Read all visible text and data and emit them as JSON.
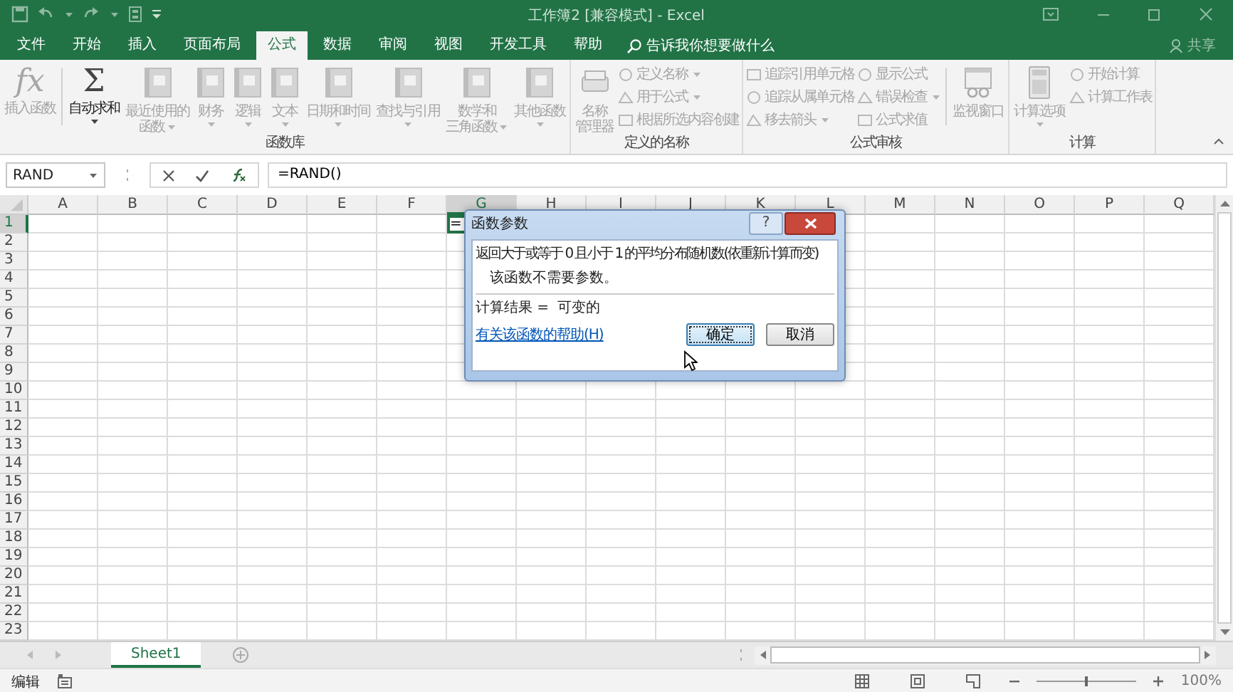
{
  "window": {
    "title": "工作簿2 [兼容模式] - Excel"
  },
  "tabs": [
    {
      "label": "文件",
      "selected": false
    },
    {
      "label": "开始",
      "selected": false
    },
    {
      "label": "插入",
      "selected": false
    },
    {
      "label": "页面布局",
      "selected": false
    },
    {
      "label": "公式",
      "selected": true
    },
    {
      "label": "数据",
      "selected": false
    },
    {
      "label": "审阅",
      "selected": false
    },
    {
      "label": "视图",
      "selected": false
    },
    {
      "label": "开发工具",
      "selected": false
    },
    {
      "label": "帮助",
      "selected": false
    }
  ],
  "tell_me": {
    "placeholder": "告诉我你想要做什么"
  },
  "share": "共享",
  "ribbon": {
    "groups": [
      {
        "label": "函数库",
        "items": [
          {
            "kind": "large",
            "glyph": "fx",
            "label": [
              "插入函数"
            ],
            "disabled": true,
            "separator_after": true
          },
          {
            "kind": "large",
            "glyph": "Σ",
            "label": [
              "自动求和"
            ],
            "disabled": false,
            "dropdown": true
          },
          {
            "kind": "large",
            "label": [
              "最近使用的",
              "函数"
            ],
            "disabled": true,
            "dropdown": true
          },
          {
            "kind": "large",
            "label": [
              "财务"
            ],
            "disabled": true,
            "dropdown": true
          },
          {
            "kind": "large",
            "label": [
              "逻辑"
            ],
            "disabled": true,
            "dropdown": true
          },
          {
            "kind": "large",
            "label": [
              "文本"
            ],
            "disabled": true,
            "dropdown": true
          },
          {
            "kind": "large",
            "label": [
              "日期和时间"
            ],
            "disabled": true,
            "dropdown": true
          },
          {
            "kind": "large",
            "label": [
              "查找与引用"
            ],
            "disabled": true,
            "dropdown": true
          },
          {
            "kind": "large",
            "label": [
              "数学和",
              "三角函数"
            ],
            "disabled": true,
            "dropdown": true
          },
          {
            "kind": "large",
            "label": [
              "其他函数"
            ],
            "disabled": true,
            "dropdown": true
          }
        ]
      },
      {
        "label": "定义的名称",
        "items": [
          {
            "kind": "large",
            "label": [
              "名称",
              "管理器"
            ],
            "disabled": true
          },
          {
            "kind": "column",
            "buttons": [
              {
                "label": "定义名称",
                "disabled": true,
                "dropdown": true
              },
              {
                "label": "用于公式",
                "disabled": true,
                "dropdown": true
              },
              {
                "label": "根据所选内容创建",
                "disabled": true
              }
            ]
          }
        ]
      },
      {
        "label": "公式审核",
        "items": [
          {
            "kind": "column",
            "buttons": [
              {
                "label": "追踪引用单元格",
                "disabled": true
              },
              {
                "label": "追踪从属单元格",
                "disabled": true
              },
              {
                "label": "移去箭头",
                "disabled": true,
                "dropdown": true
              }
            ]
          },
          {
            "kind": "column",
            "separator_after": true,
            "buttons": [
              {
                "label": "显示公式",
                "disabled": true
              },
              {
                "label": "错误检查",
                "disabled": true,
                "dropdown": true
              },
              {
                "label": "公式求值",
                "disabled": true
              }
            ]
          },
          {
            "kind": "large",
            "label": [
              "监视窗口"
            ],
            "disabled": true
          }
        ]
      },
      {
        "label": "计算",
        "items": [
          {
            "kind": "large",
            "label": [
              "计算选项"
            ],
            "disabled": true,
            "dropdown": true
          },
          {
            "kind": "column",
            "buttons": [
              {
                "label": "开始计算",
                "disabled": true
              },
              {
                "label": "计算工作表",
                "disabled": true
              }
            ]
          }
        ]
      }
    ]
  },
  "name_box": {
    "value": "RAND"
  },
  "formula_bar": {
    "value": "=RAND()"
  },
  "sheet": {
    "columns": [
      {
        "label": "A",
        "selected": false
      },
      {
        "label": "B",
        "selected": false
      },
      {
        "label": "C",
        "selected": false
      },
      {
        "label": "D",
        "selected": false
      },
      {
        "label": "E",
        "selected": false
      },
      {
        "label": "F",
        "selected": false
      },
      {
        "label": "G",
        "selected": true
      },
      {
        "label": "H",
        "selected": false
      },
      {
        "label": "I",
        "selected": false
      },
      {
        "label": "J",
        "selected": false
      },
      {
        "label": "K",
        "selected": false
      },
      {
        "label": "L",
        "selected": false
      },
      {
        "label": "M",
        "selected": false
      },
      {
        "label": "N",
        "selected": false
      },
      {
        "label": "O",
        "selected": false
      },
      {
        "label": "P",
        "selected": false
      },
      {
        "label": "Q",
        "selected": false
      }
    ],
    "rows": [
      {
        "label": "1",
        "selected": true
      },
      {
        "label": "2",
        "selected": false
      },
      {
        "label": "3",
        "selected": false
      },
      {
        "label": "4",
        "selected": false
      },
      {
        "label": "5",
        "selected": false
      },
      {
        "label": "6",
        "selected": false
      },
      {
        "label": "7",
        "selected": false
      },
      {
        "label": "8",
        "selected": false
      },
      {
        "label": "9",
        "selected": false
      },
      {
        "label": "10",
        "selected": false
      },
      {
        "label": "11",
        "selected": false
      },
      {
        "label": "12",
        "selected": false
      },
      {
        "label": "13",
        "selected": false
      },
      {
        "label": "14",
        "selected": false
      },
      {
        "label": "15",
        "selected": false
      },
      {
        "label": "16",
        "selected": false
      },
      {
        "label": "17",
        "selected": false
      },
      {
        "label": "18",
        "selected": false
      },
      {
        "label": "19",
        "selected": false
      },
      {
        "label": "20",
        "selected": false
      },
      {
        "label": "21",
        "selected": false
      },
      {
        "label": "22",
        "selected": false
      },
      {
        "label": "23",
        "selected": false
      }
    ],
    "active_cell": {
      "value": "="
    }
  },
  "dialog": {
    "title": "函数参数",
    "help_glyph": "?",
    "description": "返回大于或等于 0 且小于 1 的平均分布随机数(依重新计算而变)",
    "note": "该函数不需要参数。",
    "result_label": "计算结果 =",
    "result_value": "可变的",
    "help_link": "有关该函数的帮助(H)",
    "buttons": [
      {
        "label": "确定",
        "focused": true
      },
      {
        "label": "取消",
        "focused": false
      }
    ]
  },
  "sheet_tabs": [
    {
      "label": "Sheet1",
      "selected": true
    }
  ],
  "status_bar": {
    "mode": "编辑",
    "zoom": "100%",
    "zoom_level": {
      "level": 0.5
    }
  }
}
